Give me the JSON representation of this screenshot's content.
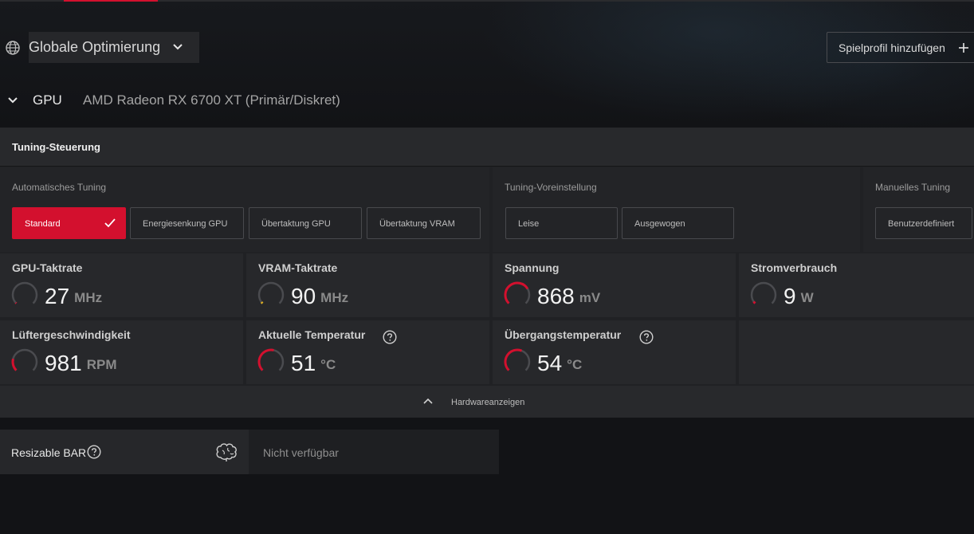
{
  "header": {
    "scope_label": "Globale Optimierung",
    "add_profile_label": "Spielprofil hinzufügen"
  },
  "gpu": {
    "label": "GPU",
    "name": "AMD Radeon RX 6700 XT (Primär/Diskret)"
  },
  "tuning": {
    "title": "Tuning-Steuerung",
    "groups": [
      {
        "title": "Automatisches Tuning",
        "buttons": [
          "Standard",
          "Energiesenkung GPU",
          "Übertaktung GPU",
          "Übertaktung VRAM"
        ]
      },
      {
        "title": "Tuning-Voreinstellung",
        "buttons": [
          "Leise",
          "Ausgewogen"
        ]
      },
      {
        "title": "Manuelles Tuning",
        "buttons": [
          "Benutzerdefiniert"
        ]
      }
    ],
    "selected": "Standard"
  },
  "metrics": [
    {
      "label": "GPU-Taktrate",
      "value": "27",
      "unit": "MHz",
      "level": 0.01
    },
    {
      "label": "VRAM-Taktrate",
      "value": "90",
      "unit": "MHz",
      "level": 0.03
    },
    {
      "label": "Spannung",
      "value": "868",
      "unit": "mV",
      "level": 0.72
    },
    {
      "label": "Stromverbrauch",
      "value": "9",
      "unit": "W",
      "level": 0.04
    },
    {
      "label": "Lüftergeschwindigkeit",
      "value": "981",
      "unit": "RPM",
      "level": 0.22
    },
    {
      "label": "Aktuelle Temperatur",
      "value": "51",
      "unit": "°C",
      "level": 0.55
    },
    {
      "label": "Übergangstemperatur",
      "value": "54",
      "unit": "°C",
      "level": 0.58
    }
  ],
  "hardware_toggle_label": "Hardwareanzeigen",
  "resizable_bar": {
    "label": "Resizable BAR",
    "value": "Nicht verfügbar"
  },
  "colors": {
    "accent": "#d3102e",
    "gauge_low": "#e0b020",
    "gauge_track": "#4a4b4f"
  },
  "icons": [
    "globe-icon",
    "chevron-down-icon",
    "plus-icon",
    "check-icon",
    "help-icon",
    "chevron-up-icon",
    "brain-icon"
  ]
}
